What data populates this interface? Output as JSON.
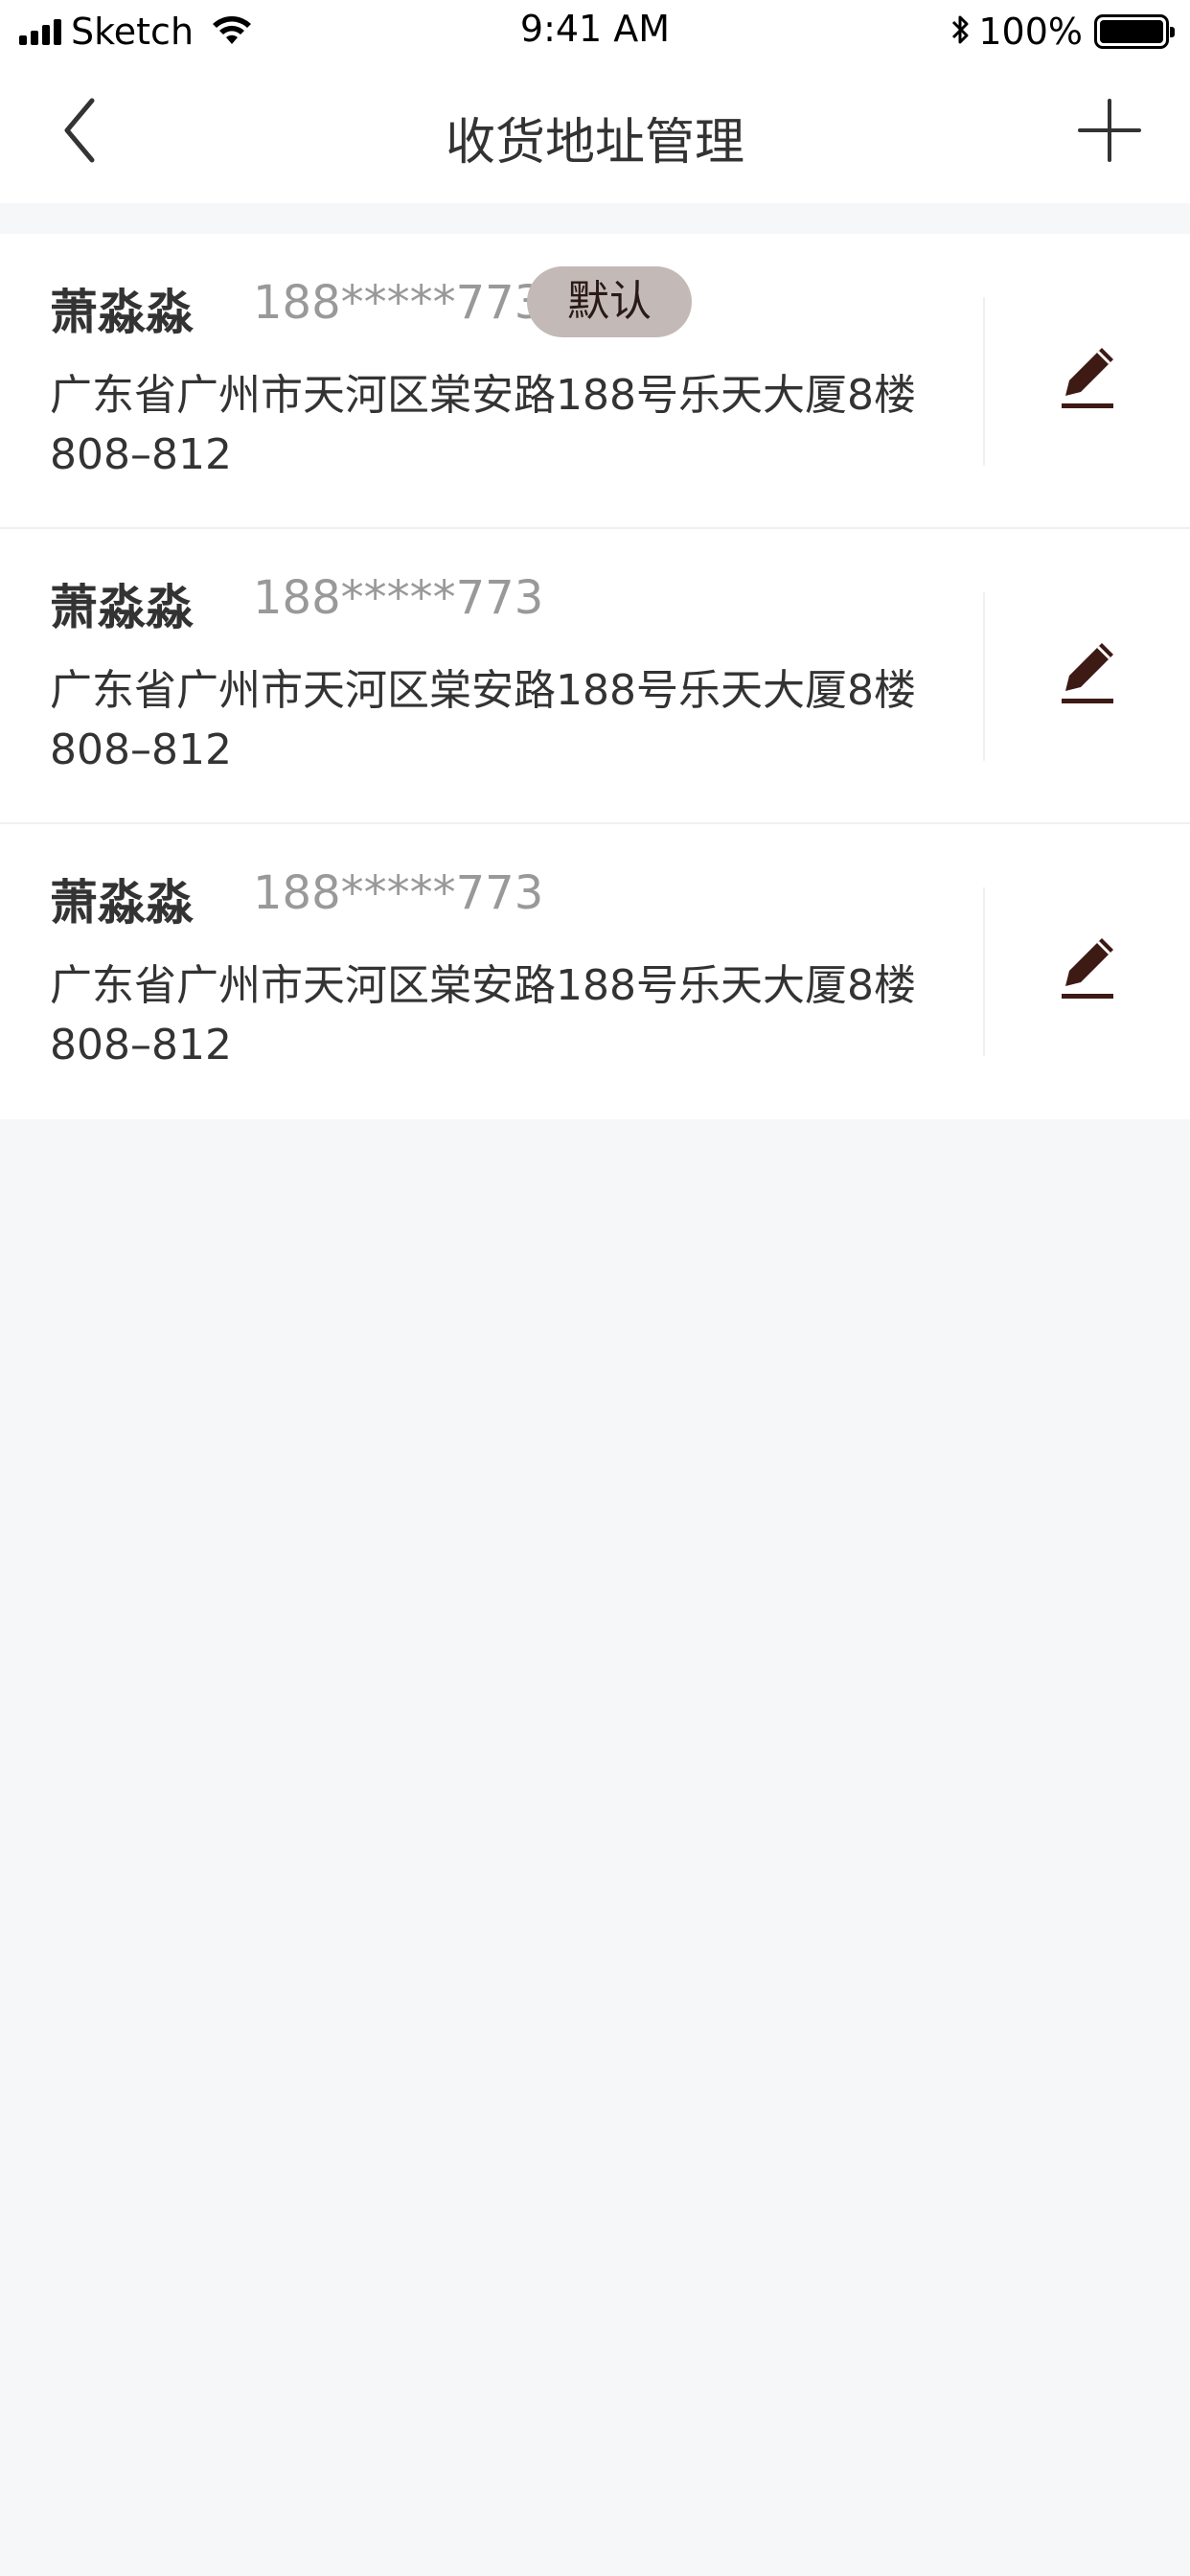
{
  "status_bar": {
    "carrier": "Sketch",
    "time": "9:41 AM",
    "battery": "100%"
  },
  "nav": {
    "title": "收货地址管理"
  },
  "addresses": [
    {
      "name": "萧淼淼",
      "phone": "188*****773",
      "default_label": "默认",
      "address": "广东省广州市天河区棠安路188号乐天大厦8楼808–812"
    },
    {
      "name": "萧淼淼",
      "phone": "188*****773",
      "address": "广东省广州市天河区棠安路188号乐天大厦8楼808–812"
    },
    {
      "name": "萧淼淼",
      "phone": "188*****773",
      "address": "广东省广州市天河区棠安路188号乐天大厦8楼808–812"
    }
  ],
  "colors": {
    "accent": "#3d1a14",
    "badge_bg": "#c3b9b6",
    "page_bg": "#f6f7f9"
  }
}
